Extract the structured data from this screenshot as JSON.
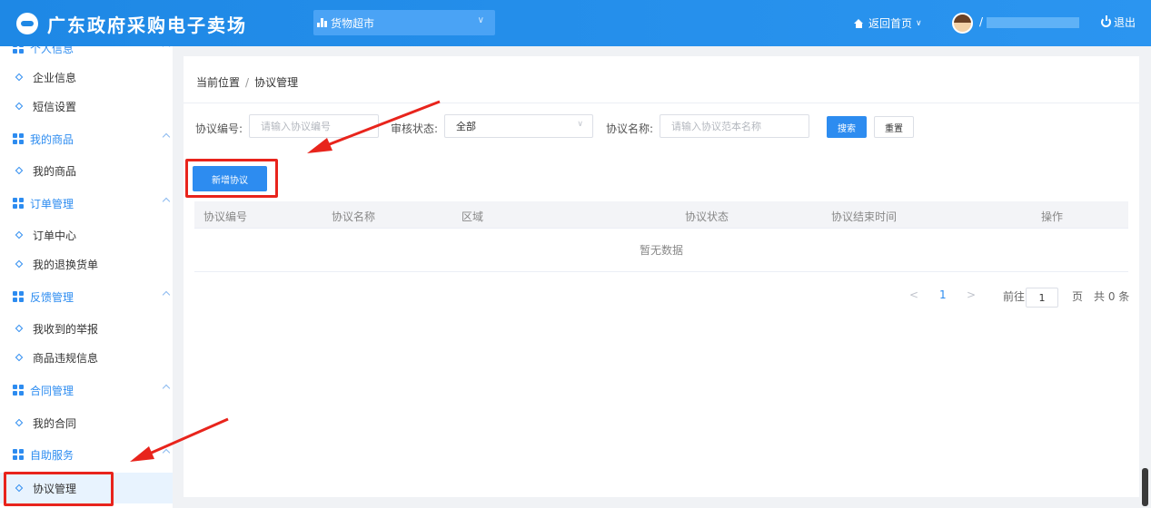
{
  "header": {
    "logo_text": "广东政府采购电子卖场",
    "category_select": "货物超市",
    "home_link": "返回首页",
    "user_name_initial": "/",
    "logout": "退出"
  },
  "sidebar": {
    "groups": [
      {
        "label": "个人信息",
        "items": [
          "企业信息",
          "短信设置"
        ]
      },
      {
        "label": "我的商品",
        "items": [
          "我的商品"
        ]
      },
      {
        "label": "订单管理",
        "items": [
          "订单中心",
          "我的退换货单"
        ]
      },
      {
        "label": "反馈管理",
        "items": [
          "我收到的举报",
          "商品违规信息"
        ]
      },
      {
        "label": "合同管理",
        "items": [
          "我的合同"
        ]
      },
      {
        "label": "自助服务",
        "items": [
          "协议管理"
        ]
      }
    ],
    "active_item": "协议管理"
  },
  "breadcrumb": {
    "root": "当前位置",
    "separator": "/",
    "current": "协议管理"
  },
  "filters": {
    "code_label": "协议编号:",
    "code_placeholder": "请输入协议编号",
    "status_label": "审核状态:",
    "status_value": "全部",
    "name_label": "协议名称:",
    "name_placeholder": "请输入协议范本名称",
    "search_button": "搜索",
    "reset_button": "重置"
  },
  "add_button": "新增协议",
  "table": {
    "columns": [
      "协议编号",
      "协议名称",
      "区域",
      "协议状态",
      "协议结束时间",
      "操作"
    ],
    "rows": [],
    "empty_text": "暂无数据"
  },
  "pagination": {
    "prev": "<",
    "current_page": "1",
    "next": ">",
    "goto_label": "前往",
    "goto_value": "1",
    "page_suffix": "页",
    "total": "共 0 条"
  },
  "annotation_colors": {
    "highlight": "#e8241c",
    "accent": "#2d8cf0"
  }
}
